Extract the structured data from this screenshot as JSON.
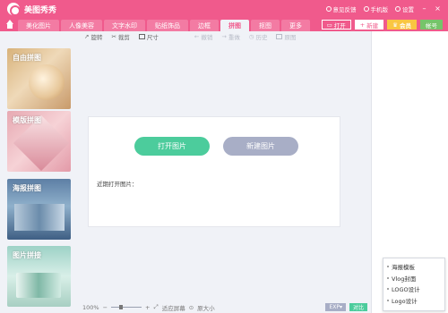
{
  "app": {
    "title": "美图秀秀"
  },
  "title_actions": {
    "feedback": "意见反馈",
    "mobile": "手机版",
    "settings": "设置"
  },
  "tabs": [
    {
      "label": "美化图片",
      "active": false
    },
    {
      "label": "人像美容",
      "active": false
    },
    {
      "label": "文字水印",
      "active": false
    },
    {
      "label": "贴纸饰品",
      "active": false
    },
    {
      "label": "边框",
      "active": false
    },
    {
      "label": "拼图",
      "active": true
    },
    {
      "label": "抠图",
      "active": false
    },
    {
      "label": "更多",
      "active": false
    }
  ],
  "tab_buttons": {
    "open": "打开",
    "new": "新建",
    "vip": "会员",
    "account": "帐号"
  },
  "toolbar": {
    "rotate": "旋转",
    "crop": "裁剪",
    "size": "尺寸",
    "undo": "撤销",
    "redo": "重做",
    "history": "历史",
    "compare": "原图"
  },
  "sidebar": {
    "cards": [
      {
        "label": "自由拼图"
      },
      {
        "label": "模版拼图"
      },
      {
        "label": "海报拼图"
      },
      {
        "label": "图片拼接"
      }
    ]
  },
  "main": {
    "open_button": "打开图片",
    "new_button": "新建图片",
    "recent_label": "近期打开图片："
  },
  "statusbar": {
    "zoom": "100%",
    "fit": "适应屏幕",
    "original": "原大小",
    "export": "EXP",
    "compare": "对比"
  },
  "menu": {
    "items": [
      "海报模板",
      "Vlog封面",
      "LOGO设计",
      "Logo设计"
    ]
  },
  "colors": {
    "brand": "#f05a8c",
    "accent_green": "#4ccc9c",
    "muted_button": "#a8aec6",
    "vip_gold": "#f9c642"
  },
  "zoom_level": 0.3
}
